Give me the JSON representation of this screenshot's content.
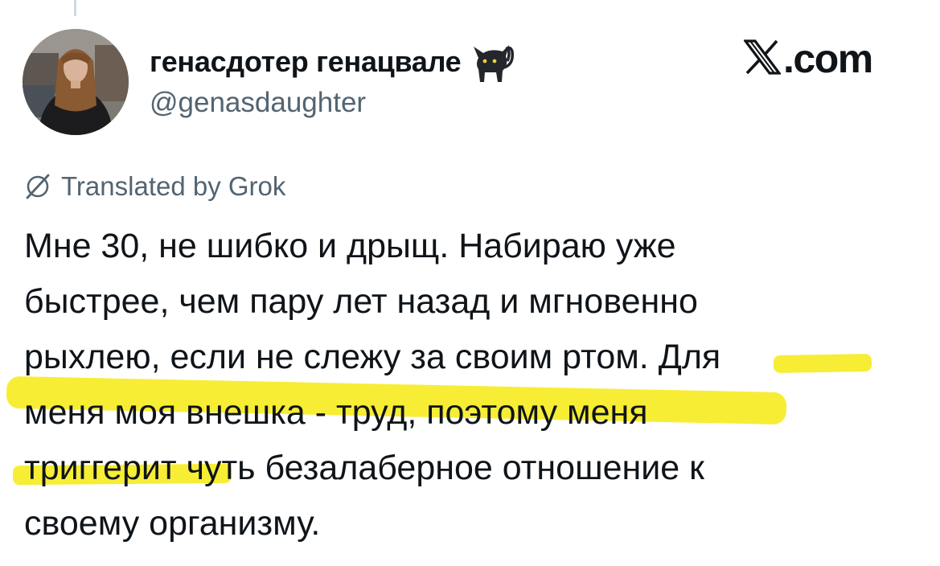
{
  "author": {
    "display_name": "генасдотер генацвале",
    "handle": "@genasdaughter",
    "avatar_icon": "profile-photo",
    "badge_emoji": "black-cat-emoji"
  },
  "brand": {
    "logo_icon": "x-logo-icon",
    "domain": ".com"
  },
  "translation": {
    "icon": "grok-icon",
    "label": "Translated by Grok"
  },
  "tweet": {
    "lines": [
      {
        "plain": "Мне 30, не шибко и дрыщ. Набираю уже",
        "highlight": ""
      },
      {
        "plain": "быстрее, чем пару лет назад и мгновенно",
        "highlight": ""
      },
      {
        "plain": "рыхлею, если не слежу за своим ртом. ",
        "highlight": "Для"
      },
      {
        "plain": "",
        "highlight": "меня моя внешка - труд, поэтому меня"
      },
      {
        "plain": "чуть безалаберное отношение к",
        "highlight": "триггерит"
      },
      {
        "plain": "своему организму.",
        "highlight": ""
      }
    ]
  },
  "colors": {
    "text": "#0f1419",
    "secondary": "#536471",
    "highlight": "#f7ec2a"
  }
}
